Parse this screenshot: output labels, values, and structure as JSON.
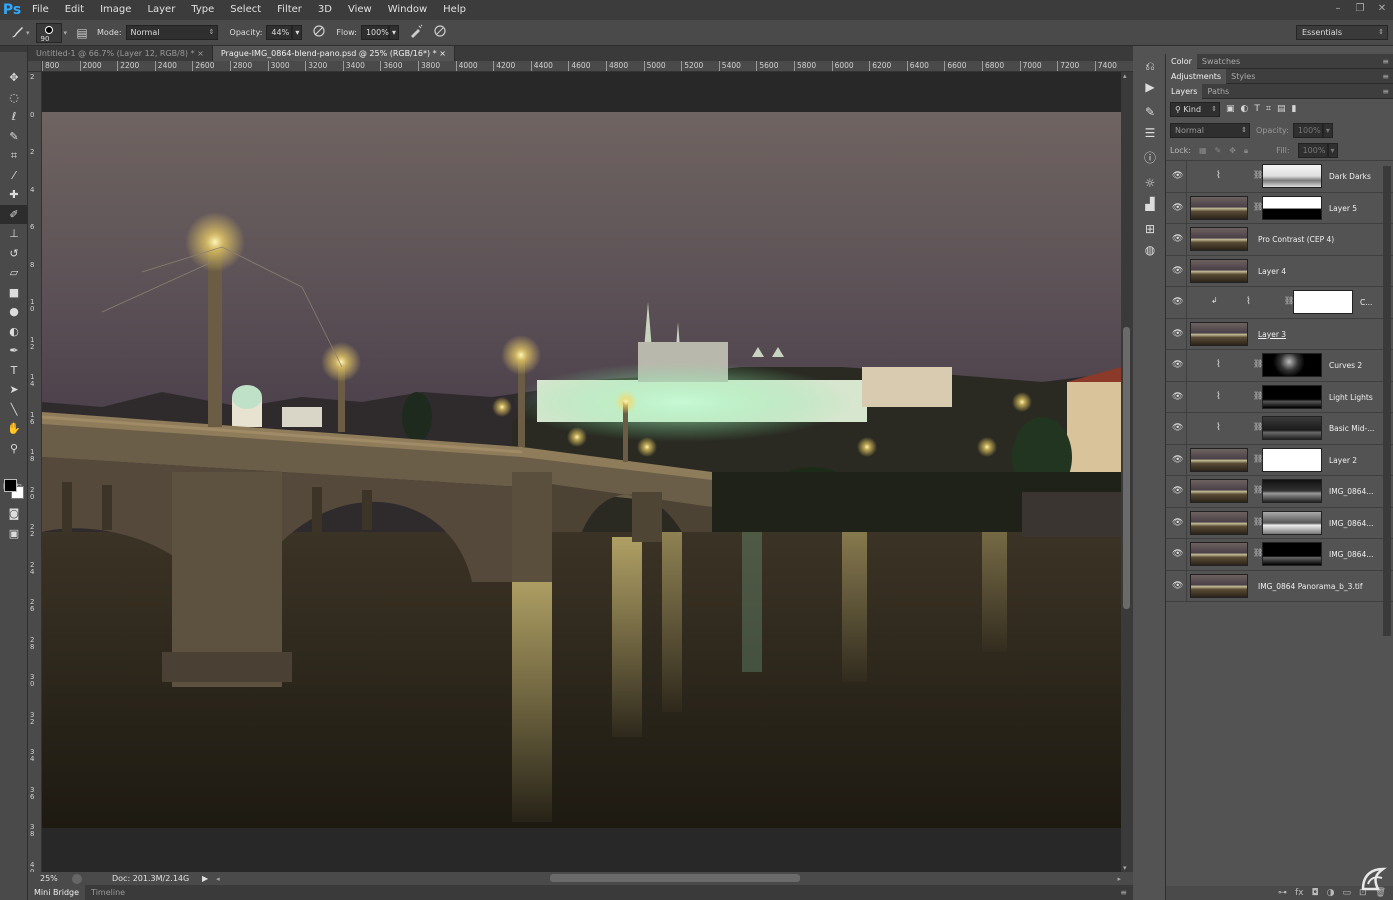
{
  "app": {
    "logo": "Ps"
  },
  "menu": [
    "File",
    "Edit",
    "Image",
    "Layer",
    "Type",
    "Select",
    "Filter",
    "3D",
    "View",
    "Window",
    "Help"
  ],
  "window_controls": [
    "–",
    "❐",
    "✕"
  ],
  "options": {
    "brush_size": "90",
    "mode_label": "Mode:",
    "mode_value": "Normal",
    "opacity_label": "Opacity:",
    "opacity_value": "44%",
    "flow_label": "Flow:",
    "flow_value": "100%",
    "workspace": "Essentials"
  },
  "tabs": [
    {
      "label": "Untitled-1 @ 66.7% (Layer 12, RGB/8) *",
      "active": false
    },
    {
      "label": "Prague-IMG_0864-blend-pano.psd @ 25% (RGB/16*) *",
      "active": true
    }
  ],
  "ruler_top": [
    "800",
    "2000",
    "2200",
    "2400",
    "2600",
    "2800",
    "3000",
    "3200",
    "3400",
    "3600",
    "3800",
    "4000",
    "4200",
    "4400",
    "4600",
    "4800",
    "5000",
    "5200",
    "5400",
    "5600",
    "5800",
    "6000",
    "6200",
    "6400",
    "6600",
    "6800",
    "7000",
    "7200",
    "7400"
  ],
  "ruler_left": [
    "2",
    "0",
    "2",
    "4",
    "6",
    "8",
    "1\n0",
    "1\n2",
    "1\n4",
    "1\n6",
    "1\n8",
    "2\n0",
    "2\n2",
    "2\n4",
    "2\n6",
    "2\n8",
    "3\n0",
    "3\n2",
    "3\n4",
    "3\n6",
    "3\n8",
    "4\n0"
  ],
  "status": {
    "zoom": "25%",
    "doc": "Doc: 201.3M/2.14G"
  },
  "bottom_tabs": [
    "Mini Bridge",
    "Timeline"
  ],
  "panels": {
    "tabs_top": [
      "Color",
      "Swatches"
    ],
    "tabs_mid": [
      "Adjustments",
      "Styles"
    ],
    "tabs_layers": [
      "Layers",
      "Paths"
    ],
    "filter_kind": "Kind",
    "blend_mode": "Normal",
    "opacity_label": "Opacity:",
    "opacity_value": "100%",
    "lock_label": "Lock:",
    "fill_label": "Fill:",
    "fill_value": "100%"
  },
  "layers": [
    {
      "name": "Dark Darks",
      "kind": "adjustment",
      "mask": "darkdarks"
    },
    {
      "name": "Layer 5",
      "kind": "pixel",
      "mask": "layer5"
    },
    {
      "name": "Pro Contrast (CEP 4)",
      "kind": "pixel",
      "mask": ""
    },
    {
      "name": "Layer 4",
      "kind": "pixel",
      "mask": ""
    },
    {
      "name": "C...",
      "kind": "clipped",
      "mask": "white"
    },
    {
      "name": "Layer 3",
      "kind": "pixel",
      "mask": ""
    },
    {
      "name": "Curves 2",
      "kind": "adjustment",
      "mask": "curves2"
    },
    {
      "name": "Light Lights",
      "kind": "adjustment",
      "mask": "lightlights"
    },
    {
      "name": "Basic Mid-...",
      "kind": "adjustment",
      "mask": "basicmid"
    },
    {
      "name": "Layer 2",
      "kind": "pixel",
      "mask": "layer2"
    },
    {
      "name": "IMG_0864...",
      "kind": "pixel",
      "mask": "img1"
    },
    {
      "name": "IMG_0864...",
      "kind": "pixel",
      "mask": "img2"
    },
    {
      "name": "IMG_0864...",
      "kind": "pixel",
      "mask": "img3"
    },
    {
      "name": "IMG_0864 Panorama_b_3.tif",
      "kind": "pixel",
      "mask": ""
    }
  ],
  "layer_bottom_icons": [
    "link-icon",
    "fx-icon",
    "mask-icon",
    "adjustment-icon",
    "folder-icon",
    "new-layer-icon",
    "trash-icon"
  ]
}
